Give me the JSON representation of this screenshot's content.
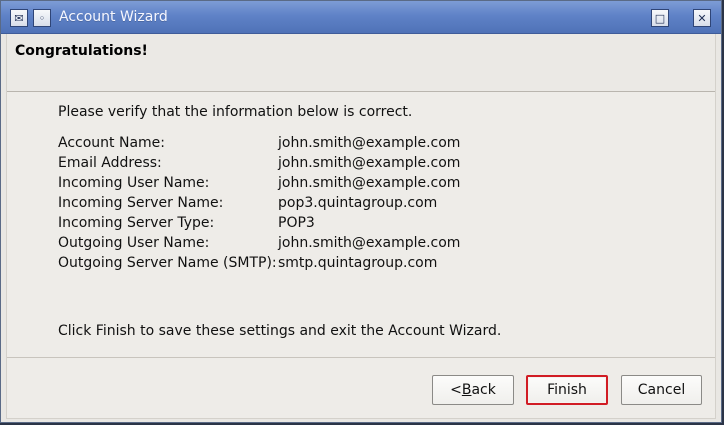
{
  "window": {
    "title": "Account Wizard"
  },
  "header": {
    "title": "Congratulations!"
  },
  "main": {
    "intro": "Please verify that the information below is correct.",
    "rows": [
      {
        "label": "Account Name:",
        "value": "john.smith@example.com"
      },
      {
        "label": "Email Address:",
        "value": "john.smith@example.com"
      },
      {
        "label": "Incoming User Name:",
        "value": "john.smith@example.com"
      },
      {
        "label": "Incoming Server Name:",
        "value": "pop3.quintagroup.com"
      },
      {
        "label": "Incoming Server Type:",
        "value": "POP3"
      },
      {
        "label": "Outgoing User Name:",
        "value": "john.smith@example.com"
      },
      {
        "label": "Outgoing Server Name (SMTP):",
        "value": "smtp.quintagroup.com"
      }
    ],
    "footer": "Click Finish to save these settings and exit the Account Wizard."
  },
  "buttons": {
    "back_prefix": "< ",
    "back_underlined": "B",
    "back_suffix": "ack",
    "finish": "Finish",
    "cancel": "Cancel"
  },
  "icons": {
    "app": "app-icon",
    "menu": "window-menu-icon",
    "maximize": "maximize-icon",
    "close": "close-icon"
  },
  "colors": {
    "titlebar_start": "#7d9cd6",
    "titlebar_end": "#4f72b7",
    "window_bg": "#eeece8",
    "focus_border": "#d11c24"
  }
}
